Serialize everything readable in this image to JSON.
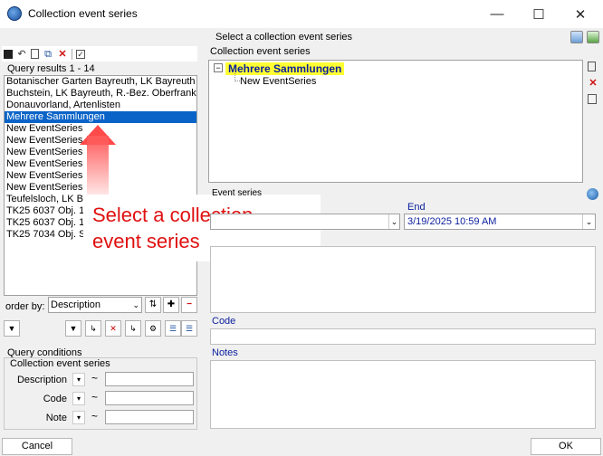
{
  "window": {
    "title": "Collection event series",
    "controls": {
      "minimize": "—",
      "maximize": "☐",
      "close": "✕"
    }
  },
  "header": {
    "label": "Select a collection event series"
  },
  "left_toolbar": {
    "icons": [
      "save-icon",
      "undo-icon",
      "new-icon",
      "copy-icon",
      "delete-icon",
      "checkbox-icon"
    ]
  },
  "query": {
    "results_label": "Query results   1 - 14",
    "items": [
      {
        "label": "Botanischer Garten Bayreuth, LK Bayreuth",
        "selected": false
      },
      {
        "label": "Buchstein, LK Bayreuth, R.-Bez. Oberfranken",
        "selected": false
      },
      {
        "label": "Donauvorland, Artenlisten",
        "selected": false
      },
      {
        "label": "Mehrere Sammlungen",
        "selected": true
      },
      {
        "label": "New EventSeries",
        "selected": false
      },
      {
        "label": "New EventSeries",
        "selected": false
      },
      {
        "label": "New EventSeries",
        "selected": false
      },
      {
        "label": "New EventSeries",
        "selected": false
      },
      {
        "label": "New EventSeries",
        "selected": false
      },
      {
        "label": "New EventSeries",
        "selected": false
      },
      {
        "label": "Teufelsloch, LK B",
        "selected": false
      },
      {
        "label": "TK25 6037 Obj. 1",
        "selected": false
      },
      {
        "label": "TK25 6037 Obj. 1",
        "selected": false
      },
      {
        "label": "TK25 7034 Obj. S",
        "selected": false
      }
    ],
    "order_by_label": "order by:",
    "order_by_value": "Description"
  },
  "callout": {
    "line1": "Select a collection",
    "line2": "event series"
  },
  "query_conditions": {
    "title": "Query conditions",
    "subtitle": "Collection event series",
    "fields": [
      {
        "label": "Description",
        "tilde": "~",
        "value": ""
      },
      {
        "label": "Code",
        "tilde": "~",
        "value": ""
      },
      {
        "label": "Note",
        "tilde": "~",
        "value": ""
      }
    ]
  },
  "tree": {
    "label": "Collection event series",
    "root": "Mehrere Sammlungen",
    "child": "New EventSeries"
  },
  "details": {
    "section_label": "Event series",
    "end_label": "End",
    "end_value": "3/19/2025 10:59 AM",
    "code_label": "Code",
    "notes_label": "Notes"
  },
  "buttons": {
    "cancel": "Cancel",
    "ok": "OK"
  },
  "colors": {
    "selection": "#0a64c8",
    "highlight": "#ffff33",
    "callout_text": "#e01010",
    "label_blue": "#0a1e9c"
  }
}
